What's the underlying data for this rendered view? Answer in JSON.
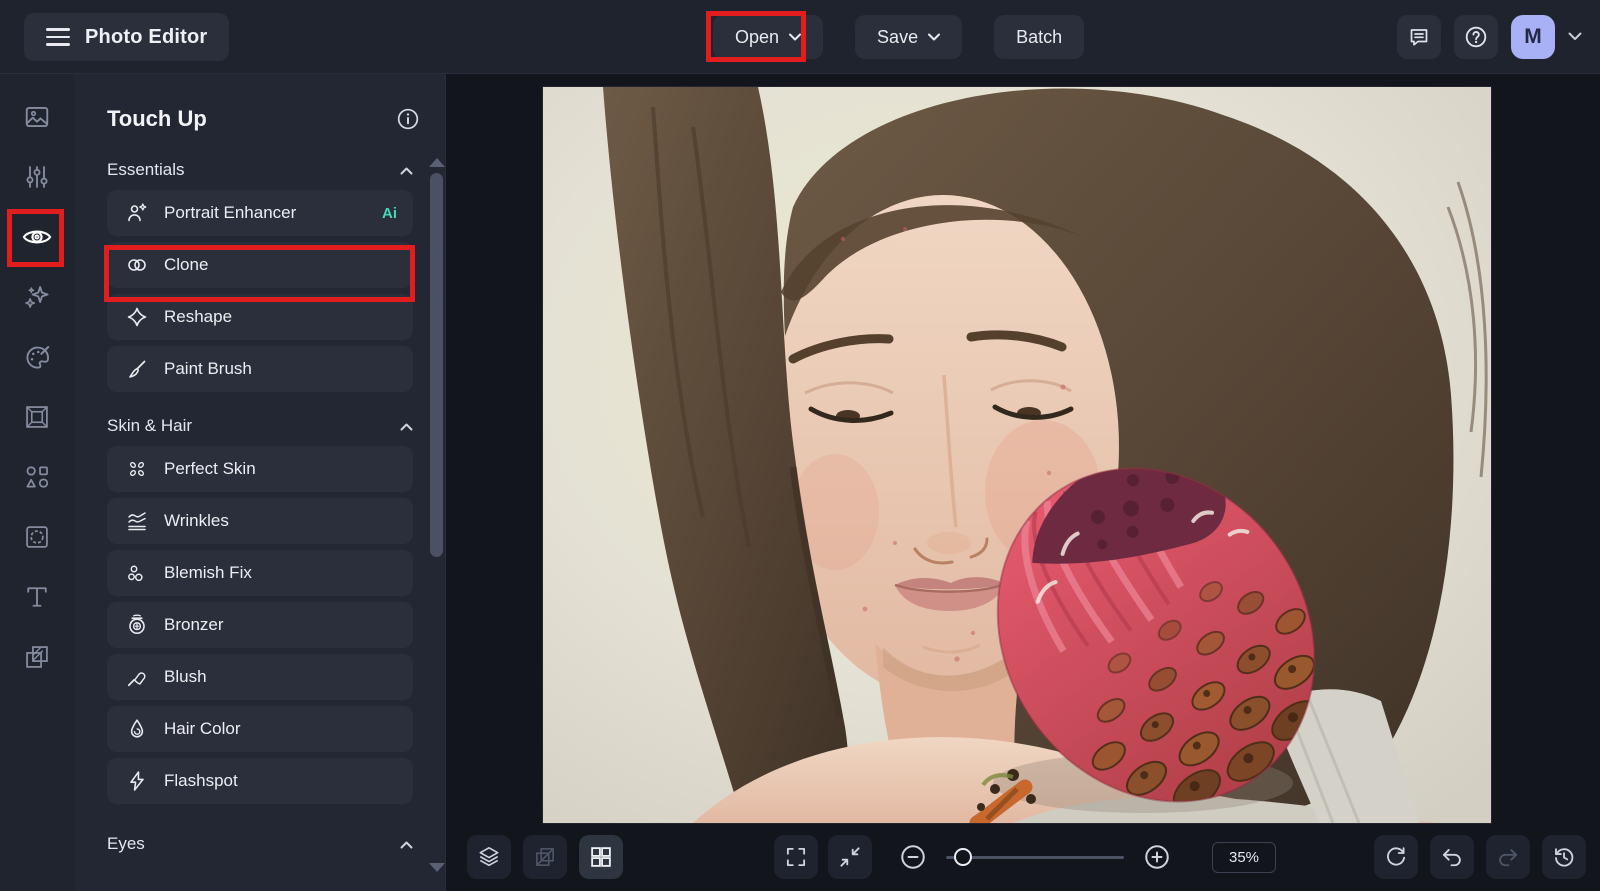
{
  "app": {
    "name": "Photo Editor"
  },
  "topbar": {
    "open_label": "Open",
    "save_label": "Save",
    "batch_label": "Batch",
    "avatar_initial": "M"
  },
  "panel": {
    "title": "Touch Up",
    "sections": [
      {
        "label": "Essentials",
        "items": [
          {
            "label": "Portrait Enhancer",
            "badge": "Ai"
          },
          {
            "label": "Clone"
          },
          {
            "label": "Reshape"
          },
          {
            "label": "Paint Brush"
          }
        ]
      },
      {
        "label": "Skin & Hair",
        "items": [
          {
            "label": "Perfect Skin"
          },
          {
            "label": "Wrinkles"
          },
          {
            "label": "Blemish Fix"
          },
          {
            "label": "Bronzer"
          },
          {
            "label": "Blush"
          },
          {
            "label": "Hair Color"
          },
          {
            "label": "Flashspot"
          }
        ]
      },
      {
        "label": "Eyes",
        "items": []
      }
    ]
  },
  "toolbar": {
    "zoom_value": "35%"
  },
  "annotations": {
    "highlighted": [
      "Open button",
      "Touch Up rail icon",
      "Clone item"
    ]
  },
  "colors": {
    "annotation_red": "#e21d1d",
    "ai_badge": "#45d6b8",
    "avatar_bg": "#a9b1f6",
    "topbar_bg": "#1f232e",
    "panel_bg": "#232733",
    "canvas_bg": "#13151d"
  }
}
